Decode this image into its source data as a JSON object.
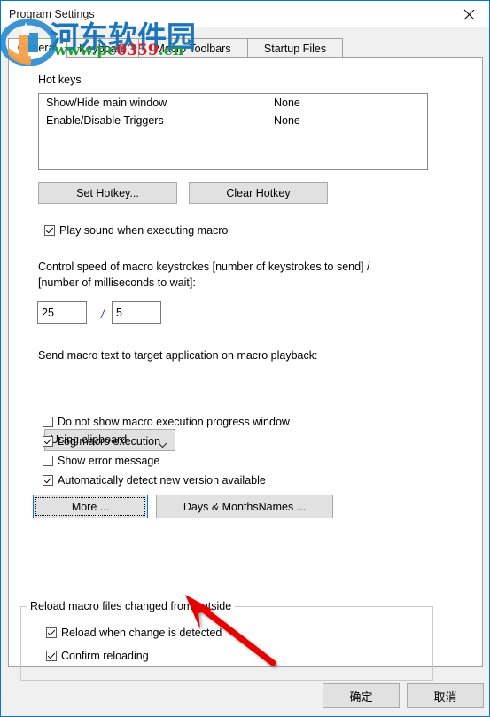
{
  "window": {
    "title": "Program Settings",
    "close_icon": "close-icon"
  },
  "tabs": [
    {
      "label": "General",
      "selected": true
    },
    {
      "label": "Keyboard",
      "selected": false
    },
    {
      "label": "Macro Toolbars",
      "selected": false
    },
    {
      "label": "Startup Files",
      "selected": false
    }
  ],
  "general": {
    "hot_keys_label": "Hot keys",
    "hotkeys": [
      {
        "name": "Show/Hide main window",
        "value": "None"
      },
      {
        "name": "Enable/Disable Triggers",
        "value": "None"
      }
    ],
    "set_hotkey_button": "Set Hotkey...",
    "clear_hotkey_button": "Clear Hotkey",
    "play_sound_checkbox": "Play sound when executing macro",
    "play_sound_checked": true,
    "speed_label_line1": "Control speed of macro keystrokes [number of keystrokes to send] /",
    "speed_label_line2": "[number of milliseconds to wait]:",
    "keystrokes_value": "25",
    "separator": "/",
    "milliseconds_value": "5",
    "send_text_label": "Send macro text to target application on macro playback:",
    "send_method_selected": "Using clipboard",
    "send_method_options": [
      "Using clipboard"
    ],
    "dropdown_icon": "chevron-down-icon",
    "no_progress_window_checkbox": "Do not show macro execution progress window",
    "no_progress_window_checked": false,
    "log_macro_checkbox": "Log macro execution",
    "log_macro_checked": true,
    "show_error_checkbox": "Show error message",
    "show_error_checked": false,
    "auto_detect_checkbox": "Automatically detect new version available",
    "auto_detect_checked": true,
    "more_button": "More ...",
    "days_months_button": "Days & MonthsNames ...",
    "reload_group_title": "Reload macro files changed from outside",
    "reload_on_change_checkbox": "Reload when change is detected",
    "reload_on_change_checked": true,
    "confirm_reloading_checkbox": "Confirm reloading",
    "confirm_reloading_checked": true
  },
  "footer": {
    "ok_button": "确定",
    "cancel_button": "取消"
  },
  "watermark": {
    "site_name": "河东软件园",
    "url_prefix": "www.pc",
    "url_digits": "0359",
    "url_suffix": ".cn",
    "logo_icon": "site-logo-icon"
  },
  "annotation": {
    "arrow_icon": "red-arrow-pointer"
  },
  "colors": {
    "window_border": "#0078d7",
    "focus_border": "#0078d7",
    "watermark_blue": "#1b75bb",
    "watermark_green": "#1f9d3a",
    "watermark_red": "#d3232a",
    "arrow_red": "#e60000",
    "button_face": "#e1e1e1",
    "dialog_face": "#f0f0f0"
  }
}
